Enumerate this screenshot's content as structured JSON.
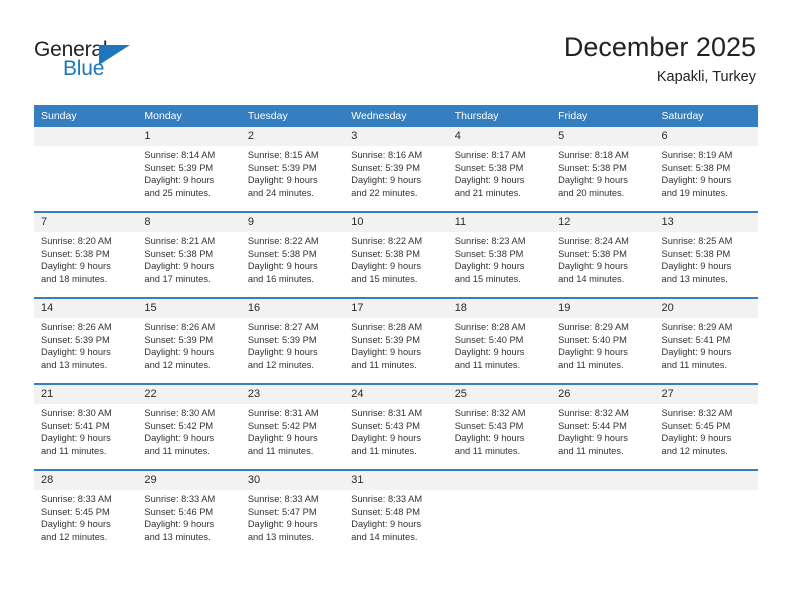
{
  "brand": {
    "name_top": "General",
    "name_bottom": "Blue",
    "color_blue": "#1f76bc",
    "color_dark": "#231f20"
  },
  "header": {
    "title": "December 2025",
    "location": "Kapakli, Turkey"
  },
  "theme": {
    "header_blue": "#357ec0",
    "daynum_band": "#f2f2f2",
    "text": "#333333"
  },
  "weekdays": [
    "Sunday",
    "Monday",
    "Tuesday",
    "Wednesday",
    "Thursday",
    "Friday",
    "Saturday"
  ],
  "weeks": [
    {
      "days": [
        {
          "num": "",
          "sunrise": "",
          "sunset": "",
          "daylight1": "",
          "daylight2": ""
        },
        {
          "num": "1",
          "sunrise": "Sunrise: 8:14 AM",
          "sunset": "Sunset: 5:39 PM",
          "daylight1": "Daylight: 9 hours",
          "daylight2": "and 25 minutes."
        },
        {
          "num": "2",
          "sunrise": "Sunrise: 8:15 AM",
          "sunset": "Sunset: 5:39 PM",
          "daylight1": "Daylight: 9 hours",
          "daylight2": "and 24 minutes."
        },
        {
          "num": "3",
          "sunrise": "Sunrise: 8:16 AM",
          "sunset": "Sunset: 5:39 PM",
          "daylight1": "Daylight: 9 hours",
          "daylight2": "and 22 minutes."
        },
        {
          "num": "4",
          "sunrise": "Sunrise: 8:17 AM",
          "sunset": "Sunset: 5:38 PM",
          "daylight1": "Daylight: 9 hours",
          "daylight2": "and 21 minutes."
        },
        {
          "num": "5",
          "sunrise": "Sunrise: 8:18 AM",
          "sunset": "Sunset: 5:38 PM",
          "daylight1": "Daylight: 9 hours",
          "daylight2": "and 20 minutes."
        },
        {
          "num": "6",
          "sunrise": "Sunrise: 8:19 AM",
          "sunset": "Sunset: 5:38 PM",
          "daylight1": "Daylight: 9 hours",
          "daylight2": "and 19 minutes."
        }
      ]
    },
    {
      "days": [
        {
          "num": "7",
          "sunrise": "Sunrise: 8:20 AM",
          "sunset": "Sunset: 5:38 PM",
          "daylight1": "Daylight: 9 hours",
          "daylight2": "and 18 minutes."
        },
        {
          "num": "8",
          "sunrise": "Sunrise: 8:21 AM",
          "sunset": "Sunset: 5:38 PM",
          "daylight1": "Daylight: 9 hours",
          "daylight2": "and 17 minutes."
        },
        {
          "num": "9",
          "sunrise": "Sunrise: 8:22 AM",
          "sunset": "Sunset: 5:38 PM",
          "daylight1": "Daylight: 9 hours",
          "daylight2": "and 16 minutes."
        },
        {
          "num": "10",
          "sunrise": "Sunrise: 8:22 AM",
          "sunset": "Sunset: 5:38 PM",
          "daylight1": "Daylight: 9 hours",
          "daylight2": "and 15 minutes."
        },
        {
          "num": "11",
          "sunrise": "Sunrise: 8:23 AM",
          "sunset": "Sunset: 5:38 PM",
          "daylight1": "Daylight: 9 hours",
          "daylight2": "and 15 minutes."
        },
        {
          "num": "12",
          "sunrise": "Sunrise: 8:24 AM",
          "sunset": "Sunset: 5:38 PM",
          "daylight1": "Daylight: 9 hours",
          "daylight2": "and 14 minutes."
        },
        {
          "num": "13",
          "sunrise": "Sunrise: 8:25 AM",
          "sunset": "Sunset: 5:38 PM",
          "daylight1": "Daylight: 9 hours",
          "daylight2": "and 13 minutes."
        }
      ]
    },
    {
      "days": [
        {
          "num": "14",
          "sunrise": "Sunrise: 8:26 AM",
          "sunset": "Sunset: 5:39 PM",
          "daylight1": "Daylight: 9 hours",
          "daylight2": "and 13 minutes."
        },
        {
          "num": "15",
          "sunrise": "Sunrise: 8:26 AM",
          "sunset": "Sunset: 5:39 PM",
          "daylight1": "Daylight: 9 hours",
          "daylight2": "and 12 minutes."
        },
        {
          "num": "16",
          "sunrise": "Sunrise: 8:27 AM",
          "sunset": "Sunset: 5:39 PM",
          "daylight1": "Daylight: 9 hours",
          "daylight2": "and 12 minutes."
        },
        {
          "num": "17",
          "sunrise": "Sunrise: 8:28 AM",
          "sunset": "Sunset: 5:39 PM",
          "daylight1": "Daylight: 9 hours",
          "daylight2": "and 11 minutes."
        },
        {
          "num": "18",
          "sunrise": "Sunrise: 8:28 AM",
          "sunset": "Sunset: 5:40 PM",
          "daylight1": "Daylight: 9 hours",
          "daylight2": "and 11 minutes."
        },
        {
          "num": "19",
          "sunrise": "Sunrise: 8:29 AM",
          "sunset": "Sunset: 5:40 PM",
          "daylight1": "Daylight: 9 hours",
          "daylight2": "and 11 minutes."
        },
        {
          "num": "20",
          "sunrise": "Sunrise: 8:29 AM",
          "sunset": "Sunset: 5:41 PM",
          "daylight1": "Daylight: 9 hours",
          "daylight2": "and 11 minutes."
        }
      ]
    },
    {
      "days": [
        {
          "num": "21",
          "sunrise": "Sunrise: 8:30 AM",
          "sunset": "Sunset: 5:41 PM",
          "daylight1": "Daylight: 9 hours",
          "daylight2": "and 11 minutes."
        },
        {
          "num": "22",
          "sunrise": "Sunrise: 8:30 AM",
          "sunset": "Sunset: 5:42 PM",
          "daylight1": "Daylight: 9 hours",
          "daylight2": "and 11 minutes."
        },
        {
          "num": "23",
          "sunrise": "Sunrise: 8:31 AM",
          "sunset": "Sunset: 5:42 PM",
          "daylight1": "Daylight: 9 hours",
          "daylight2": "and 11 minutes."
        },
        {
          "num": "24",
          "sunrise": "Sunrise: 8:31 AM",
          "sunset": "Sunset: 5:43 PM",
          "daylight1": "Daylight: 9 hours",
          "daylight2": "and 11 minutes."
        },
        {
          "num": "25",
          "sunrise": "Sunrise: 8:32 AM",
          "sunset": "Sunset: 5:43 PM",
          "daylight1": "Daylight: 9 hours",
          "daylight2": "and 11 minutes."
        },
        {
          "num": "26",
          "sunrise": "Sunrise: 8:32 AM",
          "sunset": "Sunset: 5:44 PM",
          "daylight1": "Daylight: 9 hours",
          "daylight2": "and 11 minutes."
        },
        {
          "num": "27",
          "sunrise": "Sunrise: 8:32 AM",
          "sunset": "Sunset: 5:45 PM",
          "daylight1": "Daylight: 9 hours",
          "daylight2": "and 12 minutes."
        }
      ]
    },
    {
      "days": [
        {
          "num": "28",
          "sunrise": "Sunrise: 8:33 AM",
          "sunset": "Sunset: 5:45 PM",
          "daylight1": "Daylight: 9 hours",
          "daylight2": "and 12 minutes."
        },
        {
          "num": "29",
          "sunrise": "Sunrise: 8:33 AM",
          "sunset": "Sunset: 5:46 PM",
          "daylight1": "Daylight: 9 hours",
          "daylight2": "and 13 minutes."
        },
        {
          "num": "30",
          "sunrise": "Sunrise: 8:33 AM",
          "sunset": "Sunset: 5:47 PM",
          "daylight1": "Daylight: 9 hours",
          "daylight2": "and 13 minutes."
        },
        {
          "num": "31",
          "sunrise": "Sunrise: 8:33 AM",
          "sunset": "Sunset: 5:48 PM",
          "daylight1": "Daylight: 9 hours",
          "daylight2": "and 14 minutes."
        },
        {
          "num": "",
          "sunrise": "",
          "sunset": "",
          "daylight1": "",
          "daylight2": ""
        },
        {
          "num": "",
          "sunrise": "",
          "sunset": "",
          "daylight1": "",
          "daylight2": ""
        },
        {
          "num": "",
          "sunrise": "",
          "sunset": "",
          "daylight1": "",
          "daylight2": ""
        }
      ]
    }
  ]
}
